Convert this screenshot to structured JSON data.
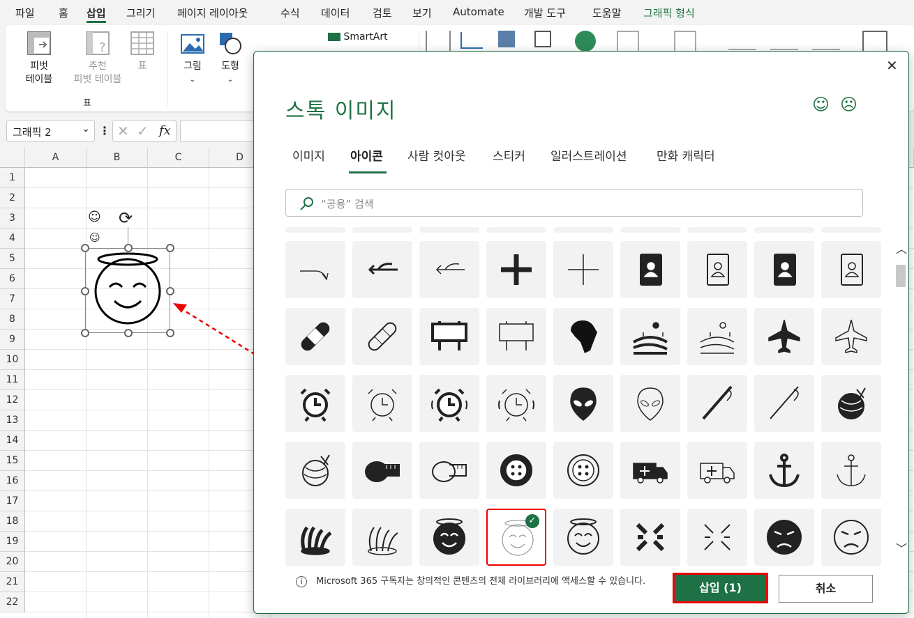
{
  "menu": {
    "items": [
      "파일",
      "홈",
      "삽입",
      "그리기",
      "페이지 레이아웃",
      "수식",
      "데이터",
      "검토",
      "보기",
      "Automate",
      "개발 도구",
      "도움말",
      "그래픽 형식"
    ]
  },
  "ribbon": {
    "pivot_label_1": "피벗",
    "pivot_label_2": "테이블",
    "recommended_label_1": "추천",
    "recommended_label_2": "피벗 테이블",
    "table_label": "표",
    "group_tables": "표",
    "picture_label": "그림",
    "shapes_label": "도형",
    "smartart_label": "SmartArt"
  },
  "formula_bar": {
    "name_box": "그래픽 2",
    "fx": "fx"
  },
  "sheet": {
    "columns": [
      "A",
      "B",
      "C",
      "D"
    ],
    "rows": [
      "1",
      "2",
      "3",
      "4",
      "5",
      "6",
      "7",
      "8",
      "9",
      "10",
      "11",
      "12",
      "13",
      "14",
      "15",
      "16",
      "17",
      "18",
      "19",
      "20",
      "21",
      "22"
    ]
  },
  "dialog": {
    "title": "스톡 이미지",
    "tabs": [
      "이미지",
      "아이콘",
      "사람 컷아웃",
      "스티커",
      "일러스트레이션",
      "만화 캐릭터"
    ],
    "active_tab": "아이콘",
    "search_placeholder": "“공용” 검색",
    "footer_note": "Microsoft 365 구독자는 창의적인 콘텐츠의 전체 라이브러리에 액세스할 수 있습니다.",
    "insert_label": "삽입 (1)",
    "cancel_label": "취소",
    "accent_color": "#1e7145",
    "icons": [
      [
        "arrow-curve-right-icon",
        "arrow-left-thick-icon",
        "arrow-left-thin-icon",
        "plus-thick-icon",
        "plus-thin-icon",
        "contact-book-filled-icon",
        "contact-book-outline-icon",
        "contact-book-filled-2-icon",
        "contact-book-outline-2-icon"
      ],
      [
        "bandage-filled-icon",
        "bandage-outline-icon",
        "billboard-filled-icon",
        "billboard-outline-icon",
        "africa-icon",
        "farm-filled-icon",
        "farm-outline-icon",
        "airplane-filled-icon",
        "airplane-outline-icon"
      ],
      [
        "alarm-clock-filled-icon",
        "alarm-clock-outline-icon",
        "alarm-ringing-filled-icon",
        "alarm-ringing-outline-icon",
        "alien-filled-icon",
        "alien-outline-icon",
        "needle-filled-icon",
        "needle-outline-icon",
        "yarn-filled-icon"
      ],
      [
        "yarn-outline-icon",
        "tape-measure-filled-icon",
        "tape-measure-outline-icon",
        "button-filled-icon",
        "button-outline-icon",
        "ambulance-filled-icon",
        "ambulance-outline-icon",
        "anchor-filled-icon",
        "anchor-outline-icon"
      ],
      [
        "anemone-filled-icon",
        "anemone-outline-icon",
        "angel-face-filled-icon",
        "angel-face-thin-icon",
        "angel-face-outline-icon",
        "anger-filled-icon",
        "anger-outline-icon",
        "angry-face-filled-icon",
        "angry-face-outline-icon"
      ]
    ]
  }
}
